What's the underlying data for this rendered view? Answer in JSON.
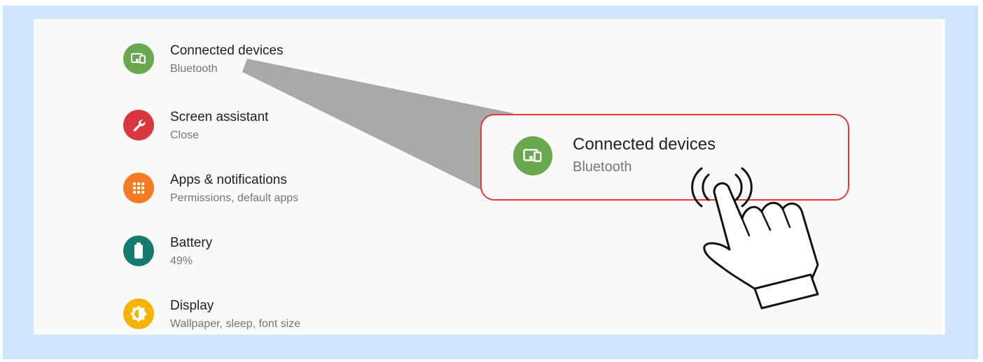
{
  "settings": {
    "items": [
      {
        "title": "Connected devices",
        "subtitle": "Bluetooth",
        "icon": "devices-icon",
        "color": "#6aa84f"
      },
      {
        "title": "Screen assistant",
        "subtitle": "Close",
        "icon": "wrench-icon",
        "color": "#d9363e"
      },
      {
        "title": "Apps & notifications",
        "subtitle": "Permissions, default apps",
        "icon": "apps-grid-icon",
        "color": "#f57c20"
      },
      {
        "title": "Battery",
        "subtitle": "49%",
        "icon": "battery-icon",
        "color": "#137c6e"
      },
      {
        "title": "Display",
        "subtitle": "Wallpaper, sleep, font size",
        "icon": "brightness-icon",
        "color": "#f5b400"
      }
    ]
  },
  "callout": {
    "title": "Connected devices",
    "subtitle": "Bluetooth",
    "icon": "devices-icon",
    "border_color": "#e53935"
  },
  "colors": {
    "frame_background": "#cfe4f8",
    "screen_background": "#fafafa",
    "wedge": "#a9a9a9"
  }
}
